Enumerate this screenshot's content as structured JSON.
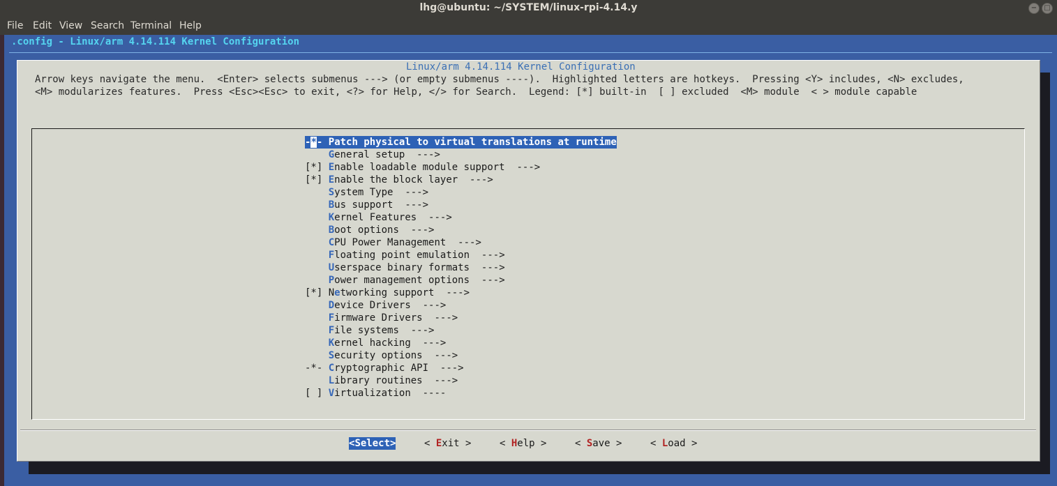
{
  "window": {
    "title": "lhg@ubuntu: ~/SYSTEM/linux-rpi-4.14.y"
  },
  "menubar": [
    "File",
    "Edit",
    "View",
    "Search",
    "Terminal",
    "Help"
  ],
  "config_title": ".config - Linux/arm 4.14.114 Kernel Configuration",
  "dialog": {
    "title": "Linux/arm 4.14.114 Kernel Configuration",
    "help_line1": "Arrow keys navigate the menu.  <Enter> selects submenus ---> (or empty submenus ----).  Highlighted letters are hotkeys.  Pressing <Y> includes, <N> excludes,",
    "help_line2": "<M> modularizes features.  Press <Esc><Esc> to exit, <?> for Help, </> for Search.  Legend: [*] built-in  [ ] excluded  <M> module  < > module capable"
  },
  "items": [
    {
      "prefix": "-*-",
      "hotkey": "P",
      "rest": "atch physical to virtual translations at runtime",
      "suffix": "",
      "selected": true
    },
    {
      "prefix": "   ",
      "hotkey": "G",
      "rest": "eneral setup",
      "suffix": "  --->"
    },
    {
      "prefix": "[*]",
      "hotkey": "E",
      "rest": "nable loadable module support",
      "suffix": "  --->"
    },
    {
      "prefix": "[*]",
      "hotkey": "E",
      "rest": "nable the block layer",
      "suffix": "  --->"
    },
    {
      "prefix": "   ",
      "hotkey": "S",
      "rest": "ystem Type",
      "suffix": "  --->"
    },
    {
      "prefix": "   ",
      "hotkey": "B",
      "rest": "us support",
      "suffix": "  --->"
    },
    {
      "prefix": "   ",
      "hotkey": "K",
      "rest": "ernel Features",
      "suffix": "  --->"
    },
    {
      "prefix": "   ",
      "hotkey": "B",
      "rest": "oot options",
      "suffix": "  --->"
    },
    {
      "prefix": "   ",
      "hotkey": "C",
      "rest": "PU Power Management",
      "suffix": "  --->"
    },
    {
      "prefix": "   ",
      "hotkey": "F",
      "rest": "loating point emulation",
      "suffix": "  --->"
    },
    {
      "prefix": "   ",
      "hotkey": "U",
      "rest": "serspace binary formats",
      "suffix": "  --->"
    },
    {
      "prefix": "   ",
      "hotkey": "P",
      "rest": "ower management options",
      "suffix": "  --->"
    },
    {
      "prefix": "[*]",
      "pre": "N",
      "hotkey": "e",
      "rest": "tworking support",
      "suffix": "  --->"
    },
    {
      "prefix": "   ",
      "hotkey": "D",
      "rest": "evice Drivers",
      "suffix": "  --->"
    },
    {
      "prefix": "   ",
      "hotkey": "F",
      "rest": "irmware Drivers",
      "suffix": "  --->"
    },
    {
      "prefix": "   ",
      "hotkey": "F",
      "rest": "ile systems",
      "suffix": "  --->"
    },
    {
      "prefix": "   ",
      "hotkey": "K",
      "rest": "ernel hacking",
      "suffix": "  --->"
    },
    {
      "prefix": "   ",
      "hotkey": "S",
      "rest": "ecurity options",
      "suffix": "  --->"
    },
    {
      "prefix": "-*-",
      "hotkey": "C",
      "rest": "ryptographic API",
      "suffix": "  --->"
    },
    {
      "prefix": "   ",
      "hotkey": "L",
      "rest": "ibrary routines",
      "suffix": "  --->"
    },
    {
      "prefix": "[ ]",
      "hotkey": "V",
      "rest": "irtualization",
      "suffix": "  ----"
    }
  ],
  "buttons": {
    "select": {
      "left": "<",
      "hotkey": "S",
      "rest": "elect",
      "right": ">"
    },
    "exit": {
      "left": "< ",
      "hotkey": "E",
      "rest": "xit",
      "right": " >"
    },
    "help": {
      "left": "< ",
      "hotkey": "H",
      "rest": "elp",
      "right": " >"
    },
    "save": {
      "left": "< ",
      "hotkey": "S",
      "rest": "ave",
      "right": " >"
    },
    "load": {
      "left": "< ",
      "hotkey": "L",
      "rest": "oad",
      "right": " >"
    }
  },
  "colors": {
    "terminal_bg": "#3a5ea3",
    "dialog_bg": "#d7d8cf",
    "highlight": "#2e62b6",
    "hotkey": "#3667b8",
    "button_hotkey": "#b12323"
  }
}
